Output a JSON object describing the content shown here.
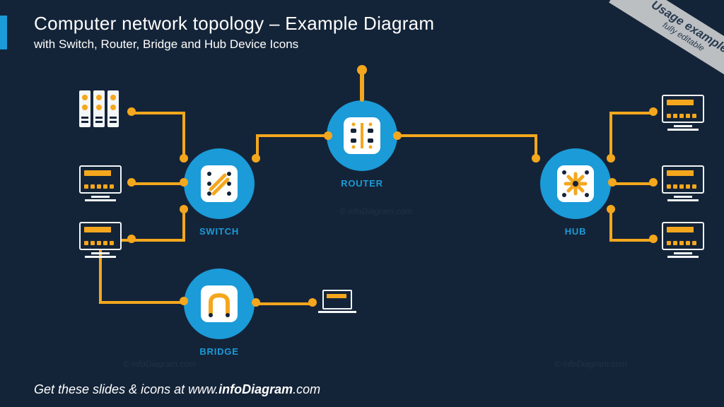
{
  "header": {
    "title": "Computer network topology – Example Diagram",
    "subtitle": "with Switch, Router, Bridge and Hub Device Icons"
  },
  "ribbon": {
    "line1": "Usage",
    "line2": "example",
    "line3": "fully editable"
  },
  "nodes": {
    "switch": "SWITCH",
    "router": "ROUTER",
    "hub": "HUB",
    "bridge": "BRIDGE"
  },
  "footer": {
    "prefix": "Get these slides & icons at www.",
    "brand": "infoDiagram",
    "suffix": ".com"
  },
  "watermark": "© infoDiagram.com",
  "colors": {
    "bg": "#142438",
    "accent": "#1b9bd8",
    "wire": "#f4a71d",
    "light": "#f3f6f8"
  }
}
